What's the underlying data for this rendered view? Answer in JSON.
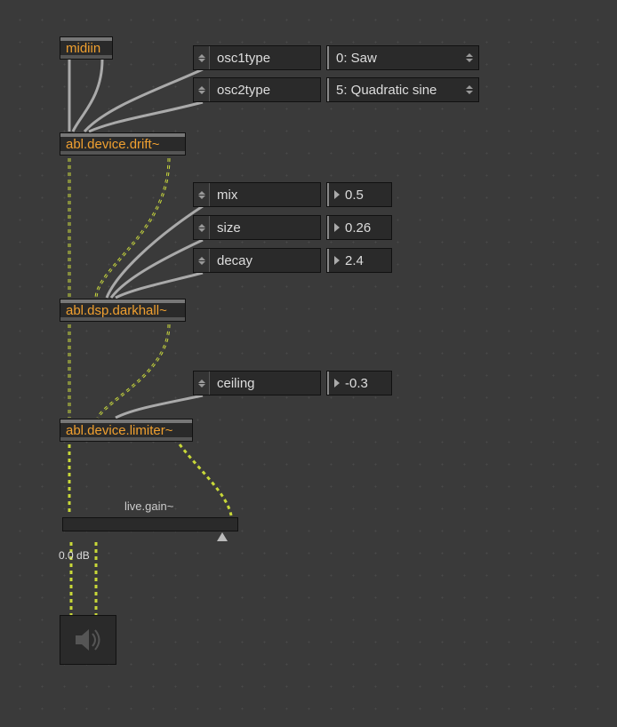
{
  "objects": {
    "midiin": {
      "label": "midiin"
    },
    "drift": {
      "label": "abl.device.drift~"
    },
    "darkhall": {
      "label": "abl.dsp.darkhall~"
    },
    "limiter": {
      "label": "abl.device.limiter~"
    }
  },
  "attrs": {
    "osc1type": {
      "name": "osc1type",
      "value": "0: Saw"
    },
    "osc2type": {
      "name": "osc2type",
      "value": "5: Quadratic sine"
    },
    "mix": {
      "name": "mix",
      "value": "0.5"
    },
    "size": {
      "name": "size",
      "value": "0.26"
    },
    "decay": {
      "name": "decay",
      "value": "2.4"
    },
    "ceiling": {
      "name": "ceiling",
      "value": "-0.3"
    }
  },
  "gain": {
    "label": "live.gain~",
    "readout": "0.0 dB"
  }
}
